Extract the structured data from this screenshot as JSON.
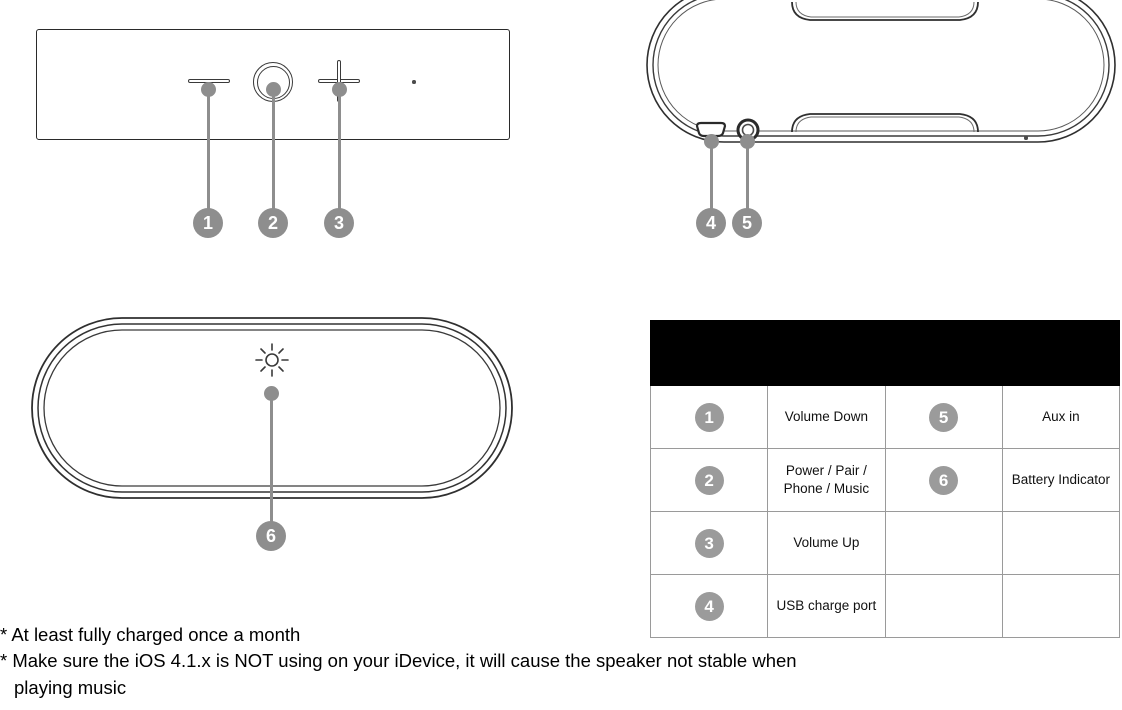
{
  "document": {
    "type": "product-diagram",
    "subject": "portable bluetooth speaker control and port layout"
  },
  "views": {
    "front": {
      "name": "Front control panel",
      "icons": [
        {
          "id": "volume-down",
          "glyph": "minus",
          "callout": "1"
        },
        {
          "id": "power-pair",
          "glyph": "double-ring",
          "callout": "2"
        },
        {
          "id": "volume-up",
          "glyph": "plus",
          "callout": "3"
        },
        {
          "id": "microphone",
          "glyph": "dot",
          "callout": ""
        }
      ]
    },
    "rear": {
      "name": "Rear port panel",
      "icons": [
        {
          "id": "usb-charge-port",
          "glyph": "micro-usb",
          "callout": "4"
        },
        {
          "id": "aux-in-jack",
          "glyph": "ring-jack",
          "callout": "5"
        },
        {
          "id": "microphone",
          "glyph": "dot",
          "callout": ""
        }
      ]
    },
    "bottom": {
      "name": "Bottom panel",
      "icons": [
        {
          "id": "battery-indicator",
          "glyph": "sun",
          "callout": "6"
        }
      ]
    }
  },
  "callouts": [
    {
      "number": "1",
      "label": "Volume Down"
    },
    {
      "number": "2",
      "label": "Power / Pair / Phone / Music"
    },
    {
      "number": "3",
      "label": "Volume Up"
    },
    {
      "number": "4",
      "label": "USB charge port"
    },
    {
      "number": "5",
      "label": "Aux in"
    },
    {
      "number": "6",
      "label": "Battery Indicator"
    }
  ],
  "legend": {
    "header_text": "",
    "rows": [
      {
        "left_num": "1",
        "left_label_lines": [
          "Volume Down"
        ],
        "right_num": "5",
        "right_label_lines": [
          "Aux in"
        ]
      },
      {
        "left_num": "2",
        "left_label_lines": [
          "Power / Pair /",
          "Phone / Music"
        ],
        "right_num": "6",
        "right_label_lines": [
          "Battery Indicator"
        ]
      },
      {
        "left_num": "3",
        "left_label_lines": [
          "Volume Up"
        ],
        "right_num": "",
        "right_label_lines": [
          ""
        ]
      },
      {
        "left_num": "4",
        "left_label_lines": [
          "USB charge port"
        ],
        "right_num": "",
        "right_label_lines": [
          ""
        ]
      }
    ]
  },
  "notes": {
    "line1": "* At least fully charged once a month",
    "line2": "* Make sure the iOS 4.1.x is NOT using on your iDevice, it will cause the speaker not stable when",
    "line3": "playing music"
  },
  "colors": {
    "callout_gray": "#8e8e8e",
    "badge_gray": "#9b9b9b",
    "outline_dark": "#2a2a2a",
    "table_border": "#9a9a9a",
    "header_black": "#000000",
    "text_black": "#000000",
    "background": "#ffffff"
  }
}
